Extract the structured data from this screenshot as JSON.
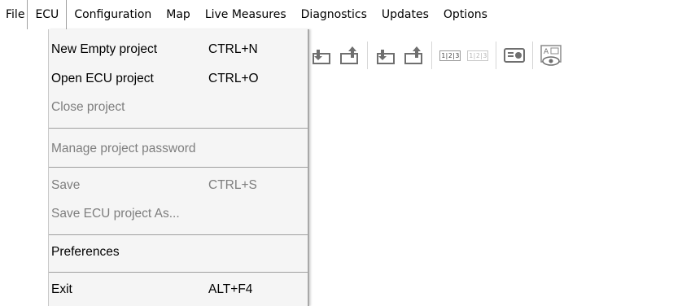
{
  "menubar": {
    "items": [
      "File",
      "ECU",
      "Configuration",
      "Map",
      "Live Measures",
      "Diagnostics",
      "Updates",
      "Options"
    ]
  },
  "file_menu": {
    "new_empty_project": {
      "label": "New Empty project",
      "shortcut": "CTRL+N"
    },
    "open_ecu_project": {
      "label": "Open ECU project",
      "shortcut": "CTRL+O"
    },
    "close_project": {
      "label": "Close project"
    },
    "manage_project_password": {
      "label": "Manage project password"
    },
    "save": {
      "label": "Save",
      "shortcut": "CTRL+S"
    },
    "save_ecu_project_as": {
      "label": "Save ECU project As..."
    },
    "preferences": {
      "label": "Preferences"
    },
    "exit": {
      "label": "Exit",
      "shortcut": "ALT+F4"
    }
  },
  "toolbar": {
    "icons": [
      "download-icon",
      "upload-icon",
      "download-icon",
      "upload-icon",
      "numbered-icon",
      "numbered-disabled-icon",
      "display-icon",
      "preview-icon"
    ],
    "numbered_text": "1|2|3",
    "preview_text": "A"
  },
  "colors": {
    "background": "#ffffff",
    "menu_background": "#f5f5f5",
    "disabled_text": "#7e7e7e",
    "separator": "#9f9f9f"
  }
}
